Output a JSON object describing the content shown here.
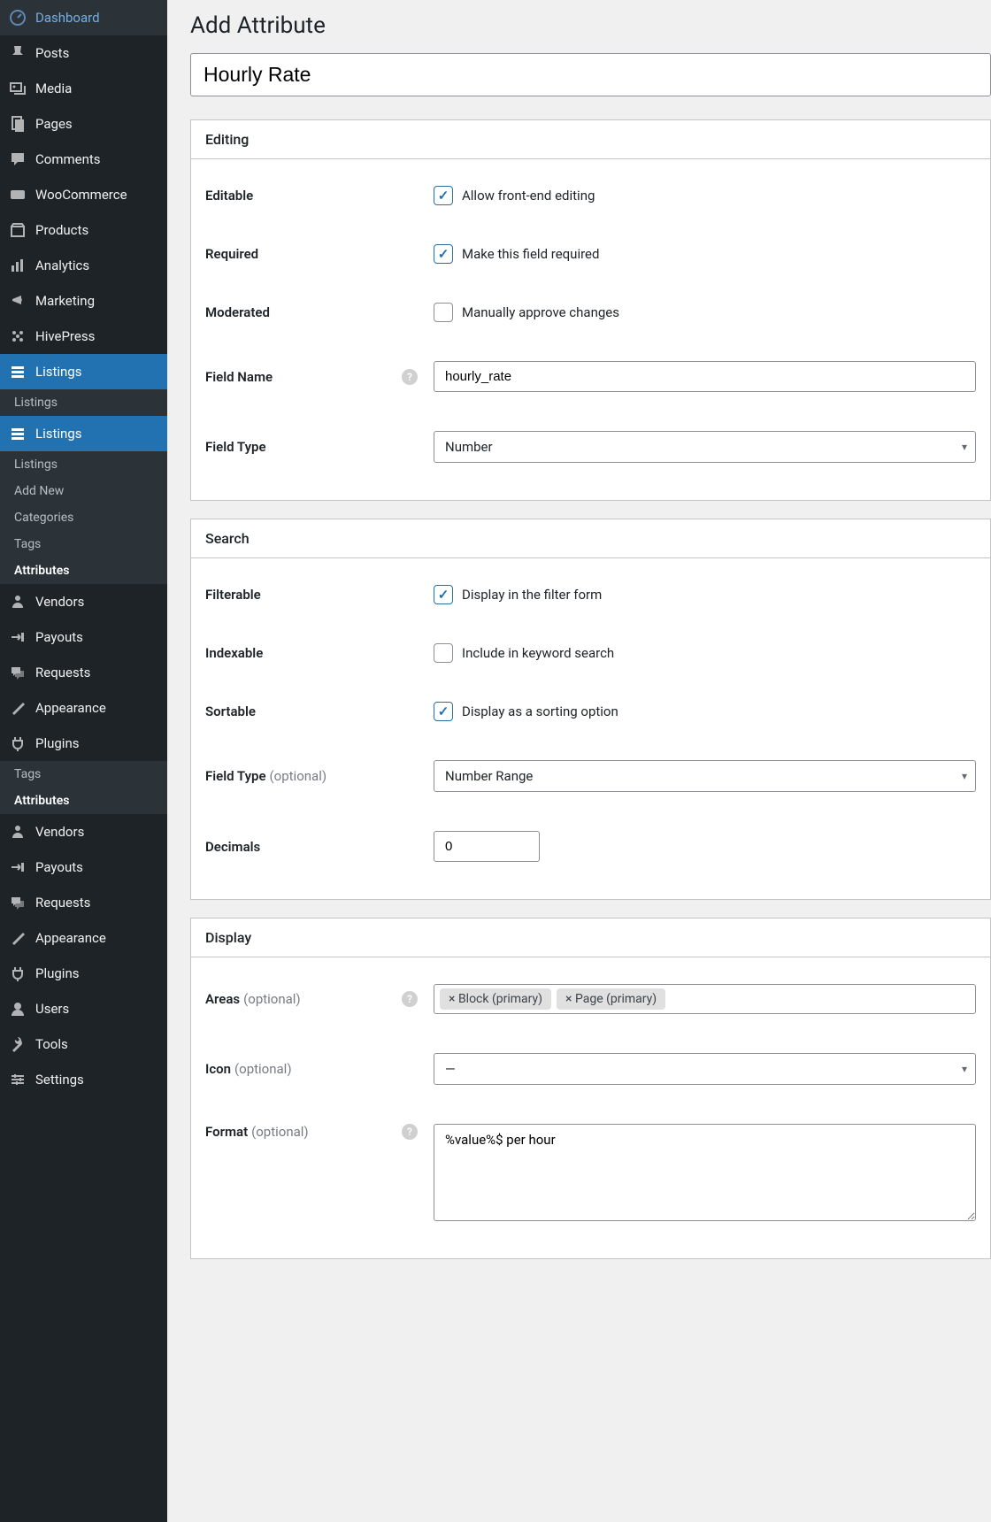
{
  "sidebar": {
    "top": [
      {
        "label": "Dashboard",
        "icon": "dashboard"
      },
      {
        "label": "Posts",
        "icon": "pin"
      },
      {
        "label": "Media",
        "icon": "media"
      },
      {
        "label": "Pages",
        "icon": "pages"
      },
      {
        "label": "Comments",
        "icon": "comments"
      },
      {
        "label": "WooCommerce",
        "icon": "woo"
      },
      {
        "label": "Products",
        "icon": "products"
      },
      {
        "label": "Analytics",
        "icon": "analytics"
      },
      {
        "label": "Marketing",
        "icon": "marketing"
      },
      {
        "label": "HivePress",
        "icon": "hivepress"
      }
    ],
    "listings1": {
      "label": "Listings",
      "sub": [
        {
          "label": "Listings"
        }
      ]
    },
    "listings2": {
      "label": "Listings",
      "sub": [
        {
          "label": "Listings"
        },
        {
          "label": "Add New"
        },
        {
          "label": "Categories"
        },
        {
          "label": "Tags"
        },
        {
          "label": "Attributes",
          "current": true
        }
      ]
    },
    "mid": [
      {
        "label": "Vendors",
        "icon": "vendors"
      },
      {
        "label": "Payouts",
        "icon": "payouts"
      },
      {
        "label": "Requests",
        "icon": "requests"
      },
      {
        "label": "Appearance",
        "icon": "appearance"
      },
      {
        "label": "Plugins",
        "icon": "plugins"
      }
    ],
    "extra_sub": [
      {
        "label": "Tags"
      },
      {
        "label": "Attributes",
        "current": true
      }
    ],
    "bottom": [
      {
        "label": "Vendors",
        "icon": "vendors"
      },
      {
        "label": "Payouts",
        "icon": "payouts"
      },
      {
        "label": "Requests",
        "icon": "requests"
      },
      {
        "label": "Appearance",
        "icon": "appearance"
      },
      {
        "label": "Plugins",
        "icon": "plugins"
      },
      {
        "label": "Users",
        "icon": "users"
      },
      {
        "label": "Tools",
        "icon": "tools"
      },
      {
        "label": "Settings",
        "icon": "settings"
      }
    ]
  },
  "page": {
    "title": "Add Attribute",
    "attr_name": "Hourly Rate"
  },
  "editing": {
    "header": "Editing",
    "editable": {
      "label": "Editable",
      "checked": true,
      "text": "Allow front-end editing"
    },
    "required": {
      "label": "Required",
      "checked": true,
      "text": "Make this field required"
    },
    "moderated": {
      "label": "Moderated",
      "checked": false,
      "text": "Manually approve changes"
    },
    "field_name": {
      "label": "Field Name",
      "value": "hourly_rate"
    },
    "field_type": {
      "label": "Field Type",
      "value": "Number"
    }
  },
  "search": {
    "header": "Search",
    "filterable": {
      "label": "Filterable",
      "checked": true,
      "text": "Display in the filter form"
    },
    "indexable": {
      "label": "Indexable",
      "checked": false,
      "text": "Include in keyword search"
    },
    "sortable": {
      "label": "Sortable",
      "checked": true,
      "text": "Display as a sorting option"
    },
    "field_type": {
      "label": "Field Type",
      "optional": "(optional)",
      "value": "Number Range"
    },
    "decimals": {
      "label": "Decimals",
      "value": "0"
    }
  },
  "display": {
    "header": "Display",
    "areas": {
      "label": "Areas",
      "optional": "(optional)",
      "tags": [
        "× Block (primary)",
        "× Page (primary)"
      ]
    },
    "icon": {
      "label": "Icon",
      "optional": "(optional)",
      "value": "—"
    },
    "format": {
      "label": "Format",
      "optional": "(optional)",
      "value": "%value%$ per hour"
    }
  }
}
